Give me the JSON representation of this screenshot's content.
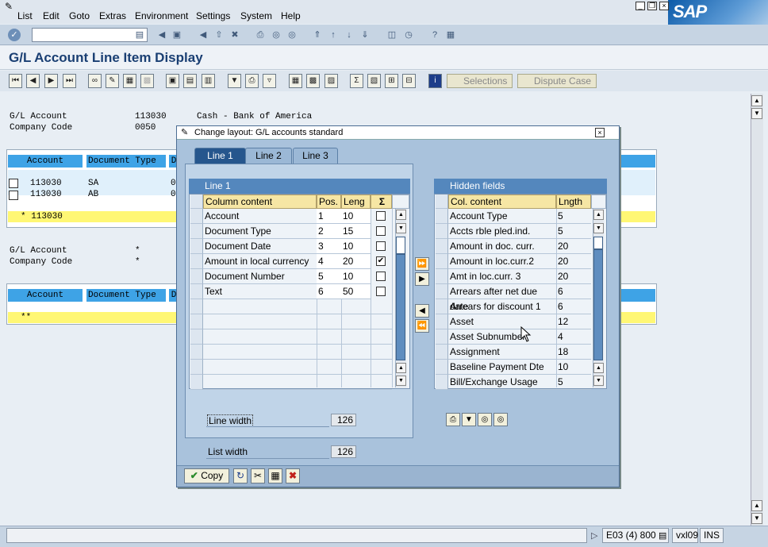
{
  "menu": {
    "items": [
      "List",
      "Edit",
      "Goto",
      "Extras",
      "Environment",
      "Settings",
      "System",
      "Help"
    ],
    "logo": "SAP"
  },
  "title": "G/L Account Line Item Display",
  "toolbar": {
    "selections_label": "Selections",
    "dispute_label": "Dispute Case"
  },
  "header1": {
    "gl_label": "G/L Account",
    "gl_value": "113030",
    "gl_desc": "Cash - Bank of America",
    "cc_label": "Company Code",
    "cc_value": "0050"
  },
  "list1": {
    "col_account": "Account",
    "col_doctype": "Document Type",
    "col_d": "D",
    "rows": [
      {
        "account": "113030",
        "doctype": "SA",
        "d": "0"
      },
      {
        "account": "113030",
        "doctype": "AB",
        "d": "0"
      }
    ],
    "total": "* 113030"
  },
  "header2": {
    "gl_label": "G/L Account",
    "gl_value": "*",
    "cc_label": "Company Code",
    "cc_value": "*"
  },
  "list2": {
    "col_account": "Account",
    "col_doctype": "Document Type",
    "col_d": "D",
    "total": "**"
  },
  "dialog": {
    "title": "Change layout: G/L accounts standard",
    "tabs": [
      "Line 1",
      "Line 2",
      "Line 3"
    ],
    "left_title": "Line 1",
    "left_cols": {
      "content": "Column content",
      "pos": "Pos.",
      "len": "Leng"
    },
    "left_rows": [
      {
        "content": "Account",
        "pos": "1",
        "len": "10",
        "sum": false
      },
      {
        "content": "Document Type",
        "pos": "2",
        "len": "15",
        "sum": false
      },
      {
        "content": "Document Date",
        "pos": "3",
        "len": "10",
        "sum": false
      },
      {
        "content": "Amount in local currency",
        "pos": "4",
        "len": "20",
        "sum": true
      },
      {
        "content": "Document Number",
        "pos": "5",
        "len": "10",
        "sum": false
      },
      {
        "content": "Text",
        "pos": "6",
        "len": "50",
        "sum": false
      }
    ],
    "right_title": "Hidden fields",
    "right_cols": {
      "content": "Col. content",
      "len": "Lngth"
    },
    "right_rows": [
      {
        "content": "Account Type",
        "len": "5"
      },
      {
        "content": "Accts rble pled.ind.",
        "len": "5"
      },
      {
        "content": "Amount in doc. curr.",
        "len": "20"
      },
      {
        "content": "Amount in loc.curr.2",
        "len": "20"
      },
      {
        "content": "Amt in loc.curr. 3",
        "len": "20"
      },
      {
        "content": "Arrears after net due date",
        "len": "6"
      },
      {
        "content": "Arrears for discount 1",
        "len": "6"
      },
      {
        "content": "Asset",
        "len": "12"
      },
      {
        "content": "Asset Subnumber",
        "len": "4"
      },
      {
        "content": "Assignment",
        "len": "18"
      },
      {
        "content": "Baseline Payment Dte",
        "len": "10"
      },
      {
        "content": "Bill/Exchange Usage",
        "len": "5"
      }
    ],
    "line_width_label": "Line width",
    "line_width_value": "126",
    "list_width_label": "List width",
    "list_width_value": "126",
    "copy_label": "Copy"
  },
  "status": {
    "session": "E03 (4) 800",
    "server": "vxl09",
    "mode": "INS"
  }
}
